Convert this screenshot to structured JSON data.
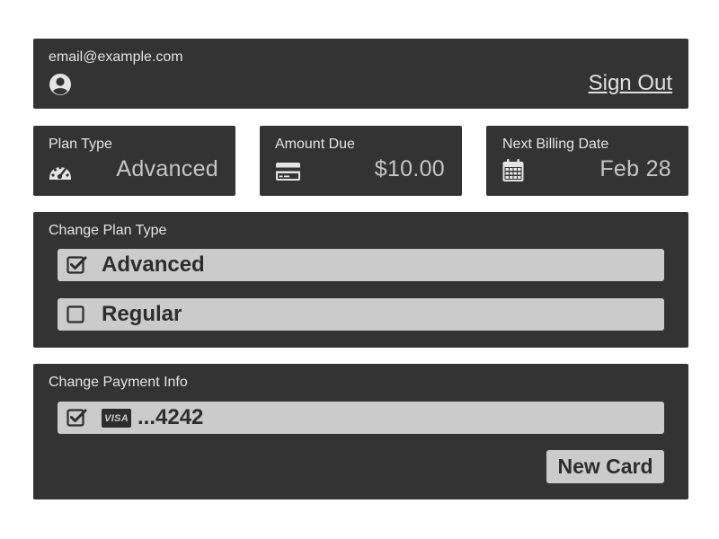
{
  "account": {
    "email": "email@example.com",
    "sign_out_label": "Sign Out",
    "user_icon": "user-circle-icon"
  },
  "summary": {
    "plan": {
      "label": "Plan Type",
      "value": "Advanced",
      "icon": "dashboard-gauge-icon"
    },
    "amount": {
      "label": "Amount Due",
      "value": "$10.00",
      "icon": "credit-card-icon"
    },
    "billing": {
      "label": "Next Billing Date",
      "value": "Feb 28",
      "icon": "calendar-icon"
    }
  },
  "plan_section": {
    "title": "Change Plan Type",
    "options": [
      {
        "label": "Advanced",
        "checked": true
      },
      {
        "label": "Regular",
        "checked": false
      }
    ]
  },
  "payment_section": {
    "title": "Change Payment Info",
    "card": {
      "brand": "VISA",
      "masked": "...4242",
      "checked": true
    },
    "new_card_label": "New Card"
  },
  "colors": {
    "panel": "#333333",
    "row": "#cbcbcb",
    "text_dark": "#2d2d2d",
    "text_light": "#e4e4e4",
    "value_muted": "#c6c6c6"
  }
}
